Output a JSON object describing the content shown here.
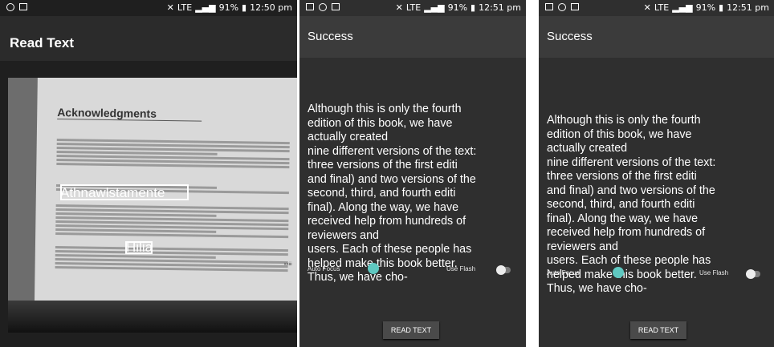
{
  "capture": {
    "status": {
      "time": "12:50 pm",
      "battery": "91%",
      "network": "LTE"
    },
    "title": "Read Text",
    "page_heading": "Acknowledgments",
    "ocr_overlays": [
      "Athnawlstamente",
      "Hilia"
    ],
    "page_number": "xxiii"
  },
  "result_a": {
    "status": {
      "time": "12:51 pm",
      "battery": "91%",
      "network": "LTE"
    },
    "title": "Success",
    "text": "Although this is only the fourth\nedition of this book, we have\nactually created\nnine different versions of the text:\nthree versions of the first editi\nand final) and two versions of the\nsecond, third, and fourth editi\nfinal). Along the way, we have\nreceived help from hundreds of\nreviewers and\nusers. Each of these people has\nhelped make this book better.\nThus, we have cho-",
    "auto_focus_label": "Auto Focus",
    "use_flash_label": "Use Flash",
    "button": "READ TEXT"
  },
  "result_b": {
    "status": {
      "time": "12:51 pm",
      "battery": "91%",
      "network": "LTE"
    },
    "title": "Success",
    "text": "Although this is only the fourth\nedition of this book, we have\nactually created\nnine different versions of the text:\nthree versions of the first editi\nand final) and two versions of the\nsecond, third, and fourth editi\nfinal). Along the way, we have\nreceived help from hundreds of\nreviewers and\nusers. Each of these people has\nhelped make this book better.\nThus, we have cho-",
    "auto_focus_label": "Auto Focus",
    "use_flash_label": "Use Flash",
    "button": "READ TEXT"
  }
}
